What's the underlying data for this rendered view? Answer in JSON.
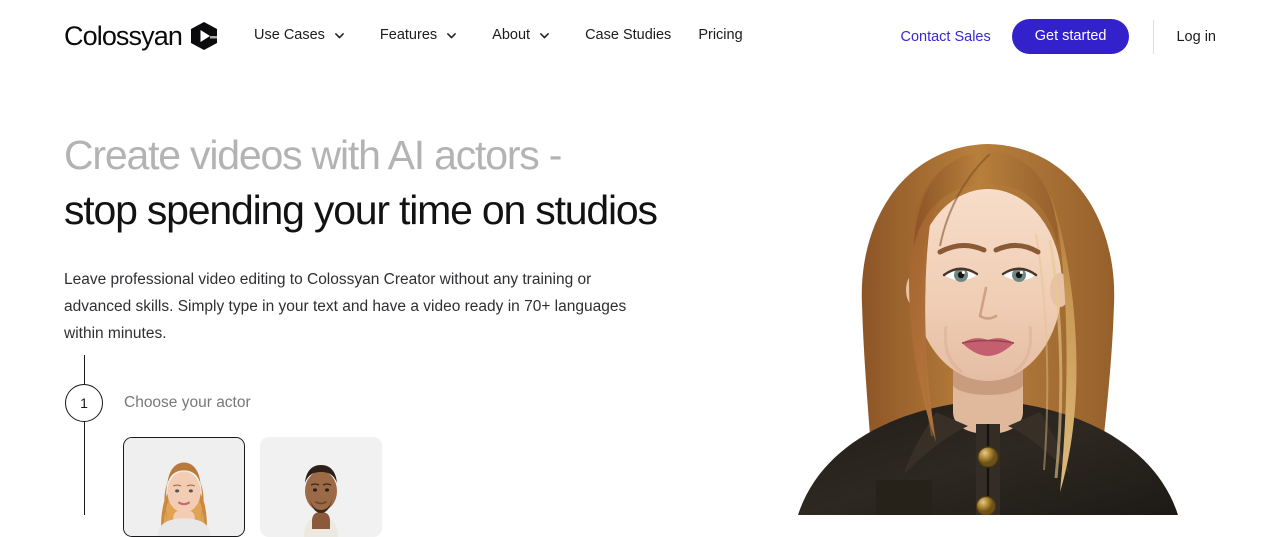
{
  "brand": {
    "name": "Colossyan",
    "logo_icon": "colossyan-hexagon-play-logo",
    "accent_color": "#3322cc",
    "link_color": "#3a27d4"
  },
  "header": {
    "nav": [
      {
        "label": "Use Cases",
        "icon": "chevron-down-icon",
        "has_dropdown": true
      },
      {
        "label": "Features",
        "icon": "chevron-down-icon",
        "has_dropdown": true
      },
      {
        "label": "About",
        "icon": "chevron-down-icon",
        "has_dropdown": true
      },
      {
        "label": "Case Studies",
        "has_dropdown": false
      },
      {
        "label": "Pricing",
        "has_dropdown": false
      }
    ],
    "contact_sales_label": "Contact Sales",
    "get_started_label": "Get started",
    "login_label": "Log in"
  },
  "hero": {
    "headline_line1": "Create videos with AI actors -",
    "headline_line2": "stop spending your time on studios",
    "paragraph": "Leave professional video editing to Colossyan Creator without any training or advanced skills. Simply type in your text and have a video ready in 70+ languages within minutes.",
    "portrait_alt": "woman-presenter-portrait"
  },
  "step": {
    "number": "1",
    "label": "Choose your actor",
    "actors": [
      {
        "name": "female-actor-thumbnail",
        "selected": true
      },
      {
        "name": "male-actor-thumbnail",
        "selected": false
      }
    ]
  }
}
